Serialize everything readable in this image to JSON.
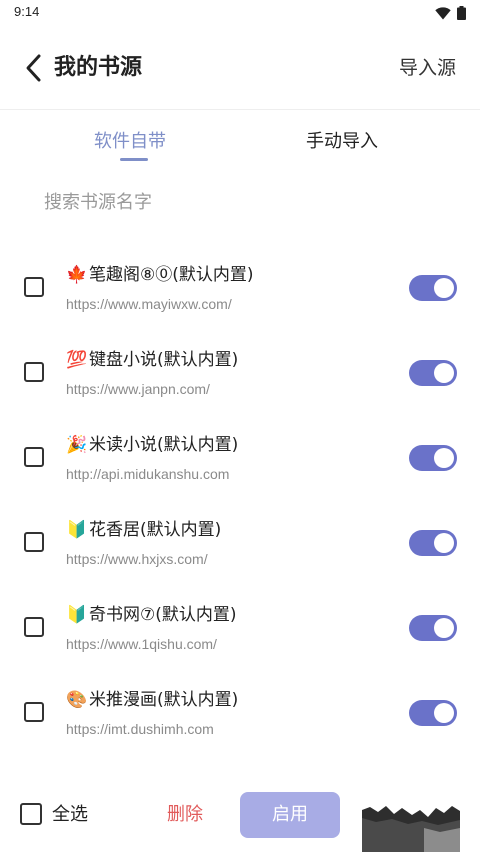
{
  "status_bar": {
    "time": "9:14"
  },
  "header": {
    "title": "我的书源",
    "import_label": "导入源"
  },
  "tabs": [
    {
      "label": "软件自带",
      "active": true
    },
    {
      "label": "手动导入",
      "active": false
    }
  ],
  "search": {
    "placeholder": "搜索书源名字",
    "value": ""
  },
  "sources": [
    {
      "emoji": "🍁",
      "name": "笔趣阁⑧⓪(默认内置)",
      "url": "https://www.mayiwxw.com/",
      "checked": false,
      "enabled": true
    },
    {
      "emoji": "💯",
      "name": "键盘小说(默认内置)",
      "url": "https://www.janpn.com/",
      "checked": false,
      "enabled": true
    },
    {
      "emoji": "🎉",
      "name": "米读小说(默认内置)",
      "url": "http://api.midukanshu.com",
      "checked": false,
      "enabled": true
    },
    {
      "emoji": "🔰",
      "name": "花香居(默认内置)",
      "url": "https://www.hxjxs.com/",
      "checked": false,
      "enabled": true
    },
    {
      "emoji": "🔰",
      "name": "奇书网⑦(默认内置)",
      "url": "https://www.1qishu.com/",
      "checked": false,
      "enabled": true
    },
    {
      "emoji": "🎨",
      "name": "米推漫画(默认内置)",
      "url": "https://imt.dushimh.com",
      "checked": false,
      "enabled": true
    }
  ],
  "footer": {
    "select_all_label": "全选",
    "delete_label": "删除",
    "enable_label": "启用"
  },
  "colors": {
    "accent": "#6a72c9",
    "tab_active": "#7f8fc8",
    "delete": "#e15a5a",
    "enable_button": "#a8ace5"
  }
}
